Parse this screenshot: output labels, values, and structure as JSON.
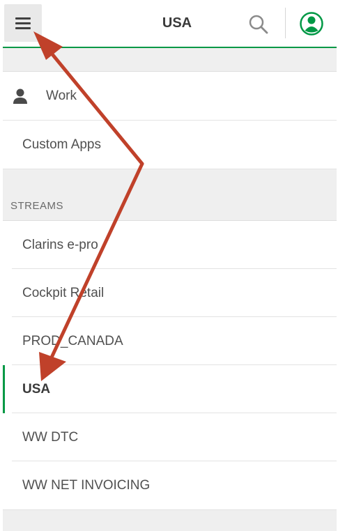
{
  "header": {
    "title": "USA",
    "menu_icon": "hamburger-menu-icon",
    "search_icon": "search-icon",
    "profile_icon": "user-profile-icon"
  },
  "menu": {
    "work": {
      "label": "Work",
      "icon": "person-icon"
    },
    "custom_apps": {
      "label": "Custom Apps"
    },
    "streams_heading": "STREAMS",
    "streams": [
      {
        "label": "Clarins e-pro"
      },
      {
        "label": "Cockpit Retail"
      },
      {
        "label": "PROD_CANADA"
      },
      {
        "label": "USA",
        "active": true
      },
      {
        "label": "WW DTC"
      },
      {
        "label": "WW NET INVOICING"
      }
    ]
  },
  "colors": {
    "accent": "#009845",
    "arrow": "#c0412a",
    "gray_bg": "#efefef"
  }
}
